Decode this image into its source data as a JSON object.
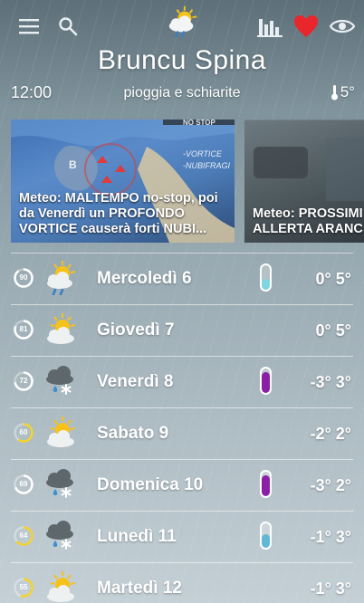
{
  "header": {
    "location": "Bruncu Spina",
    "time": "12:00",
    "condition": "pioggia e schiarite",
    "current_temp": "5°"
  },
  "toolbar": {
    "menu_icon": "menu-icon",
    "search_icon": "search-icon",
    "weather_icon": "sun-cloud-rain-icon",
    "chart_icon": "bar-chart-icon",
    "favorite_icon": "heart-icon",
    "favorite_color": "#e8262b",
    "view_icon": "eye-icon"
  },
  "news": [
    {
      "title": "Meteo: MALTEMPO no-stop, poi da Venerdì un PROFONDO VORTICE causerà forti NUBI...",
      "map_labels": [
        "NO STOP",
        "-VORTICE",
        "-NUBIFRAGI",
        "B"
      ]
    },
    {
      "title": "Meteo: PROSSIMI altre Piogge da N ALLERTA ARANC"
    }
  ],
  "forecast": [
    {
      "score": "90",
      "score_frac": 0.9,
      "score_color": "#ffffff",
      "icon": "sun-cloud-rain-icon",
      "day": "Mercoledì 6",
      "therm": "light",
      "therm_color": "#7fd6e0",
      "therm_level": 0.45,
      "min": "0°",
      "max": "5°"
    },
    {
      "score": "81",
      "score_frac": 0.81,
      "score_color": "#ffffff",
      "icon": "sun-cloud-icon",
      "day": "Giovedì 7",
      "therm": "none",
      "therm_color": "",
      "therm_level": 0,
      "min": "0°",
      "max": "5°"
    },
    {
      "score": "72",
      "score_frac": 0.72,
      "score_color": "#ffffff",
      "icon": "cloud-snow-rain-icon",
      "day": "Venerdì 8",
      "therm": "purple",
      "therm_color": "#8b1fa8",
      "therm_level": 0.85,
      "min": "-3°",
      "max": "3°"
    },
    {
      "score": "60",
      "score_frac": 0.6,
      "score_color": "#f3d22b",
      "icon": "sun-cloud-icon",
      "day": "Sabato 9",
      "therm": "none",
      "therm_color": "",
      "therm_level": 0,
      "min": "-2°",
      "max": "2°"
    },
    {
      "score": "69",
      "score_frac": 0.69,
      "score_color": "#ffffff",
      "icon": "cloud-snow-rain-icon",
      "day": "Domenica 10",
      "therm": "purple",
      "therm_color": "#8b1fa8",
      "therm_level": 0.85,
      "min": "-3°",
      "max": "2°"
    },
    {
      "score": "64",
      "score_frac": 0.64,
      "score_color": "#f3d22b",
      "icon": "cloud-snow-rain-icon",
      "day": "Lunedì 11",
      "therm": "light",
      "therm_color": "#5fb8d6",
      "therm_level": 0.55,
      "min": "-1°",
      "max": "3°"
    },
    {
      "score": "55",
      "score_frac": 0.55,
      "score_color": "#f3d22b",
      "icon": "sun-cloud-icon",
      "day": "Martedì 12",
      "therm": "none",
      "therm_color": "",
      "therm_level": 0,
      "min": "-1°",
      "max": "3°"
    }
  ]
}
